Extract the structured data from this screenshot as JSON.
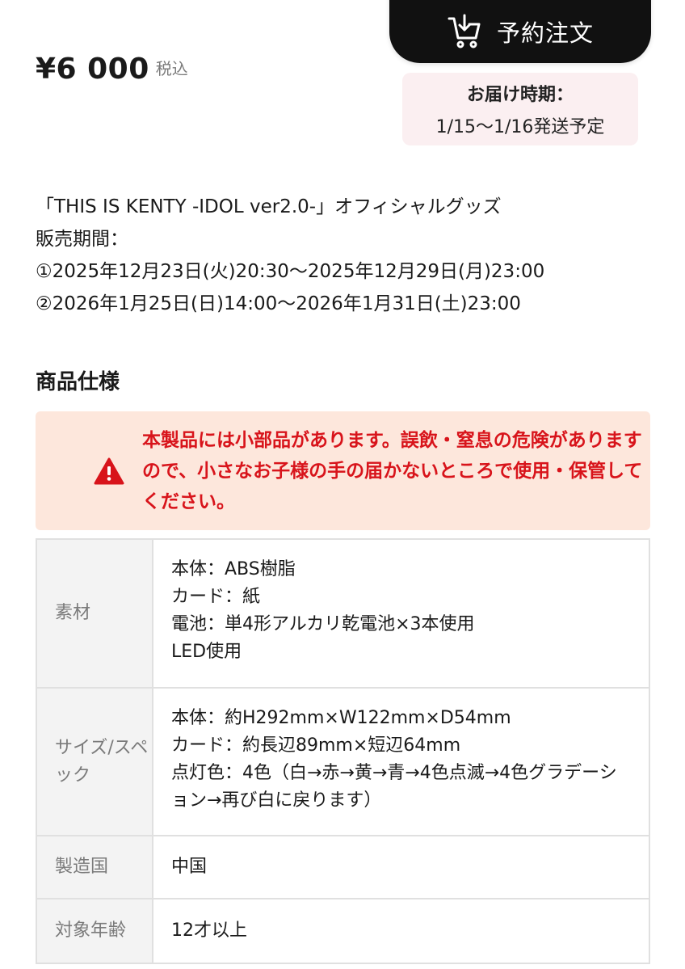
{
  "header": {
    "order_button_label": "予約注文",
    "cart_icon": "cart-download-icon"
  },
  "price": {
    "amount": "¥6 000",
    "tax_label": "税込"
  },
  "delivery": {
    "label": "お届け時期：",
    "value": "1/15〜1/16発送予定"
  },
  "description": {
    "lines": [
      "「THIS IS KENTY -IDOL ver2.0-」オフィシャルグッズ",
      "販売期間：",
      "①2025年12月23日(火)20:30〜2025年12月29日(月)23:00",
      "②2026年1月25日(日)14:00〜2026年1月31日(土)23:00"
    ]
  },
  "spec_section": {
    "title": "商品仕様",
    "warning": {
      "icon": "warning-icon",
      "text": "本製品には小部品があります。誤飲・窒息の危険がありますので、小さなお子様の手の届かないところで使用・保管してください。",
      "color": "#d8141b",
      "background": "#fde7dc"
    },
    "rows": [
      {
        "key": "素材",
        "values": [
          "本体：ABS樹脂",
          "カード：紙",
          "電池：単4形アルカリ乾電池×3本使用",
          "LED使用"
        ]
      },
      {
        "key": "サイズ/スペック",
        "values": [
          "本体：約H292mm×W122mm×D54mm",
          "カード：約長辺89mm×短辺64mm",
          "点灯色：4色（白→赤→黄→青→4色点滅→4色グラデーション→再び白に戻ります）"
        ]
      },
      {
        "key": "製造国",
        "values": [
          "中国"
        ]
      },
      {
        "key": "対象年齢",
        "values": [
          "12才以上"
        ]
      }
    ]
  }
}
